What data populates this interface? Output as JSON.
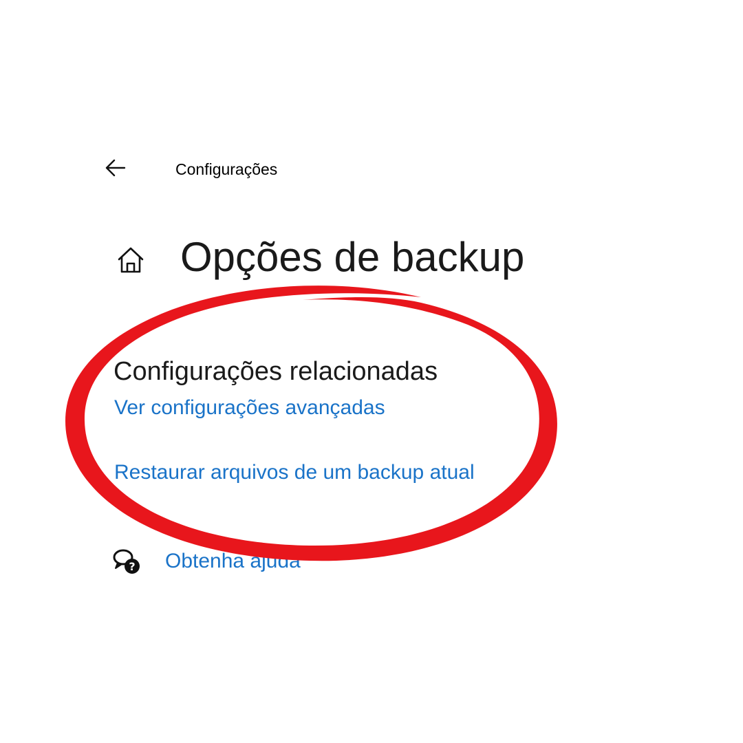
{
  "header": {
    "title": "Configurações",
    "back_icon": "arrow-left-icon"
  },
  "page": {
    "title": "Opções de backup",
    "home_icon": "home-icon"
  },
  "related": {
    "heading": "Configurações relacionadas",
    "links": [
      "Ver configurações avançadas",
      "Restaurar arquivos de um backup atual"
    ]
  },
  "help": {
    "label": "Obtenha ajuda",
    "icon": "help-chat-icon"
  },
  "colors": {
    "link": "#1a73c8",
    "annotation": "#e8161c"
  }
}
